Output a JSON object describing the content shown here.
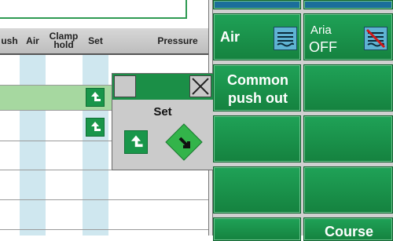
{
  "table": {
    "headers": [
      "ush",
      "Air",
      "Clamp hold",
      "Set",
      "Pressure"
    ]
  },
  "popup": {
    "title": "Set"
  },
  "buttons": {
    "air": "Air",
    "aria_line1": "Aria",
    "aria_line2": "OFF",
    "common_line1": "Common",
    "common_line2": "push out",
    "course": "Course"
  },
  "icons": [
    "set-arrow-icon",
    "rotate-arrow-icon",
    "air-icon",
    "air-off-icon",
    "minimize-icon",
    "close-icon"
  ],
  "colors": {
    "accent": "#1b9a4f",
    "selected_row": "#a6d8a0",
    "column_stripe": "#cfe7ef"
  }
}
